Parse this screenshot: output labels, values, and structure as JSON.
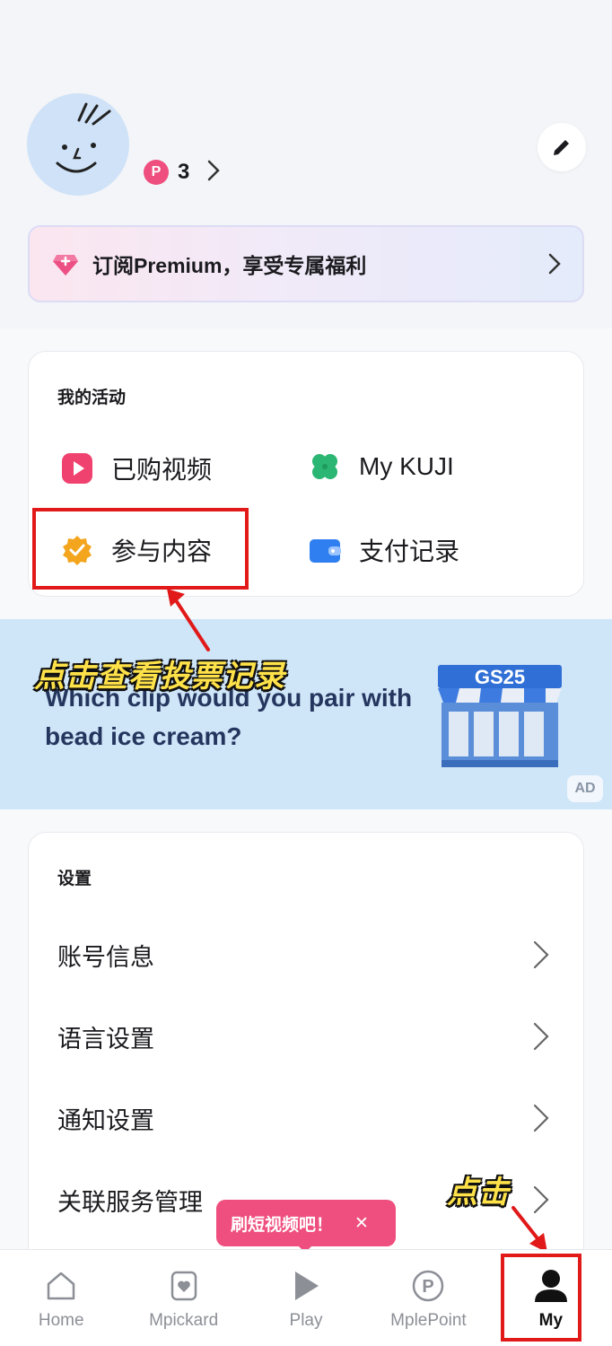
{
  "profile": {
    "points_badge": "P",
    "points_count": "3"
  },
  "premium": {
    "label": "订阅Premium，享受专属福利"
  },
  "activity": {
    "title": "我的活动",
    "items": [
      {
        "label": "已购视频",
        "icon": "play-square-icon",
        "color": "#f0426e"
      },
      {
        "label": "My KUJI",
        "icon": "clover-icon",
        "color": "#2bb673"
      },
      {
        "label": "参与内容",
        "icon": "check-badge-icon",
        "color": "#f3a51d"
      },
      {
        "label": "支付记录",
        "icon": "wallet-icon",
        "color": "#2f7ff0"
      }
    ]
  },
  "ad": {
    "text": "Which clip would you pair with bead ice cream?",
    "badge": "AD",
    "store_sign": "GS25"
  },
  "settings": {
    "title": "设置",
    "items": [
      {
        "label": "账号信息"
      },
      {
        "label": "语言设置"
      },
      {
        "label": "通知设置"
      },
      {
        "label": "关联服务管理"
      }
    ]
  },
  "tooltip": {
    "label": "刷短视频吧！",
    "close": "✕"
  },
  "nav": {
    "items": [
      {
        "label": "Home",
        "icon": "home-icon"
      },
      {
        "label": "Mpickard",
        "icon": "card-icon"
      },
      {
        "label": "Play",
        "icon": "play-icon"
      },
      {
        "label": "MplePoint",
        "icon": "point-icon",
        "icon_text": "P"
      },
      {
        "label": "My",
        "icon": "person-icon",
        "active": true
      }
    ]
  },
  "annotations": {
    "vote_hint": "点击查看投票记录",
    "click_hint": "点击"
  },
  "colors": {
    "accent_pink": "#ef4f7e",
    "annotation_red": "#e11919",
    "annotation_yellow": "#ffe249"
  }
}
